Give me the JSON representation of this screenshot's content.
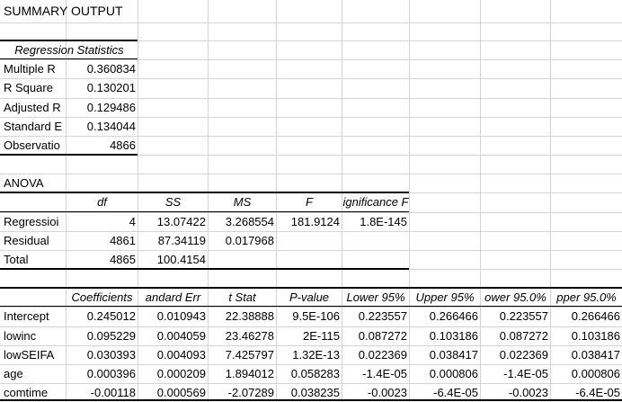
{
  "summary_title": "SUMMARY OUTPUT",
  "regression_statistics": {
    "header": "Regression Statistics",
    "rows": [
      {
        "label": "Multiple R",
        "value": "0.360834"
      },
      {
        "label": "R Square",
        "value": "0.130201"
      },
      {
        "label": "Adjusted R",
        "value": "0.129486"
      },
      {
        "label": "Standard E",
        "value": "0.134044"
      },
      {
        "label": "Observatio",
        "value": "4866"
      }
    ]
  },
  "anova": {
    "title": "ANOVA",
    "headers": [
      "",
      "df",
      "SS",
      "MS",
      "F",
      "ignificance F"
    ],
    "rows": [
      [
        "Regressioi",
        "4",
        "13.07422",
        "3.268554",
        "181.9124",
        "1.8E-145"
      ],
      [
        "Residual",
        "4861",
        "87.34119",
        "0.017968",
        "",
        ""
      ],
      [
        "Total",
        "4865",
        "100.4154",
        "",
        "",
        ""
      ]
    ]
  },
  "coefficients": {
    "headers": [
      "",
      "Coefficients",
      "andard Err",
      "t Stat",
      "P-value",
      "Lower 95%",
      "Upper 95%",
      "ower 95.0%",
      "pper 95.0%"
    ],
    "rows": [
      [
        "Intercept",
        "0.245012",
        "0.010943",
        "22.38888",
        "9.5E-106",
        "0.223557",
        "0.266466",
        "0.223557",
        "0.266466"
      ],
      [
        "lowinc",
        "0.095229",
        "0.004059",
        "23.46278",
        "2E-115",
        "0.087272",
        "0.103186",
        "0.087272",
        "0.103186"
      ],
      [
        "lowSEIFA",
        "0.030393",
        "0.004093",
        "7.425797",
        "1.32E-13",
        "0.022369",
        "0.038417",
        "0.022369",
        "0.038417"
      ],
      [
        "age",
        "0.000396",
        "0.000209",
        "1.894012",
        "0.058283",
        "-1.4E-05",
        "0.000806",
        "-1.4E-05",
        "0.000806"
      ],
      [
        "comtime",
        "-0.00118",
        "0.000569",
        "-2.07289",
        "0.038235",
        "-0.0023",
        "-6.4E-05",
        "-0.0023",
        "-6.4E-05"
      ]
    ]
  }
}
